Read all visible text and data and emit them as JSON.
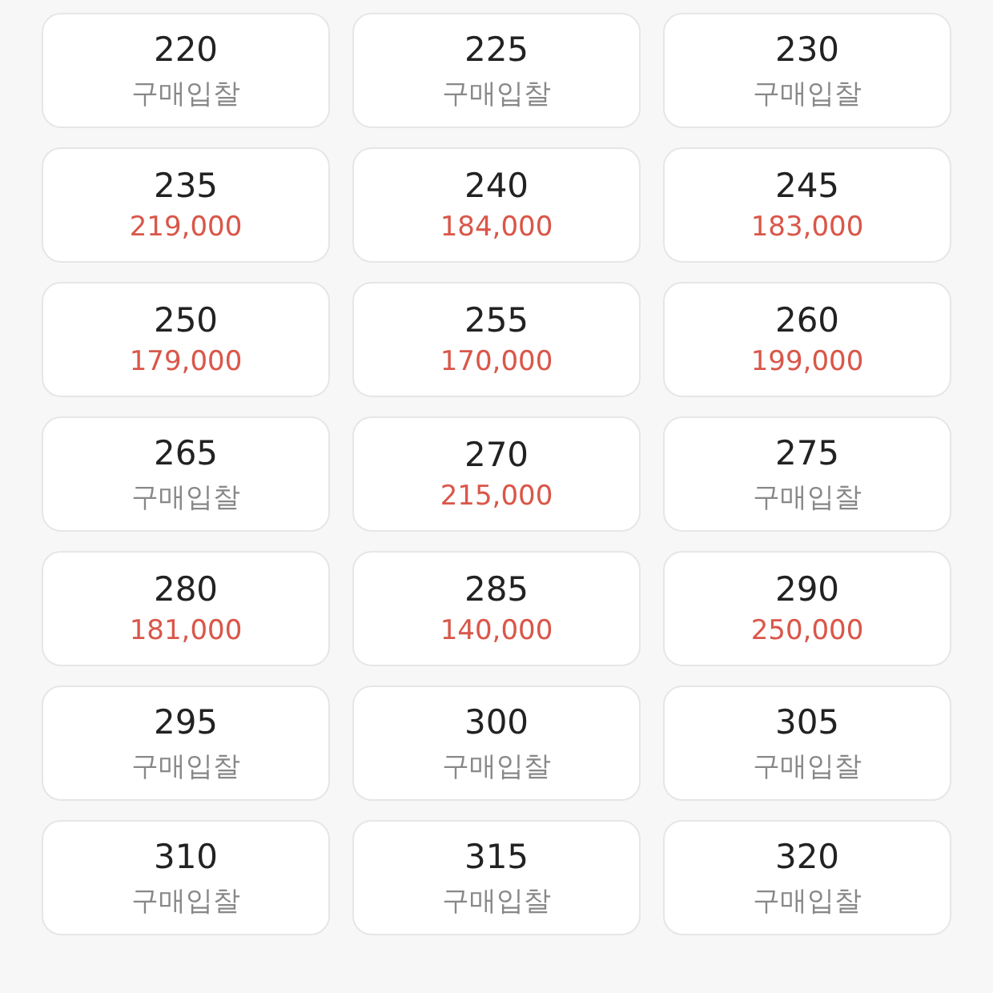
{
  "sizes": [
    {
      "size": "220",
      "kind": "bid",
      "label": "구매입찰"
    },
    {
      "size": "225",
      "kind": "bid",
      "label": "구매입찰"
    },
    {
      "size": "230",
      "kind": "bid",
      "label": "구매입찰"
    },
    {
      "size": "235",
      "kind": "price",
      "label": "219,000"
    },
    {
      "size": "240",
      "kind": "price",
      "label": "184,000"
    },
    {
      "size": "245",
      "kind": "price",
      "label": "183,000"
    },
    {
      "size": "250",
      "kind": "price",
      "label": "179,000"
    },
    {
      "size": "255",
      "kind": "price",
      "label": "170,000"
    },
    {
      "size": "260",
      "kind": "price",
      "label": "199,000"
    },
    {
      "size": "265",
      "kind": "bid",
      "label": "구매입찰"
    },
    {
      "size": "270",
      "kind": "price",
      "label": "215,000"
    },
    {
      "size": "275",
      "kind": "bid",
      "label": "구매입찰"
    },
    {
      "size": "280",
      "kind": "price",
      "label": "181,000"
    },
    {
      "size": "285",
      "kind": "price",
      "label": "140,000"
    },
    {
      "size": "290",
      "kind": "price",
      "label": "250,000"
    },
    {
      "size": "295",
      "kind": "bid",
      "label": "구매입찰"
    },
    {
      "size": "300",
      "kind": "bid",
      "label": "구매입찰"
    },
    {
      "size": "305",
      "kind": "bid",
      "label": "구매입찰"
    },
    {
      "size": "310",
      "kind": "bid",
      "label": "구매입찰"
    },
    {
      "size": "315",
      "kind": "bid",
      "label": "구매입찰"
    },
    {
      "size": "320",
      "kind": "bid",
      "label": "구매입찰"
    }
  ]
}
